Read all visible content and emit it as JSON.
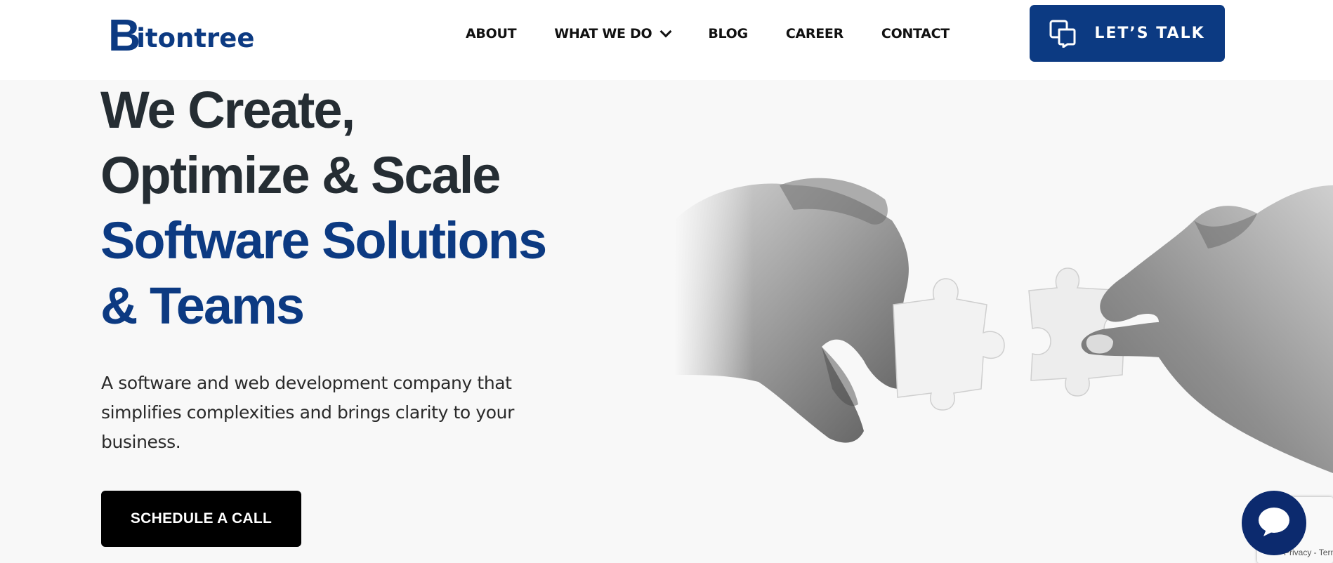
{
  "header": {
    "logo": {
      "initial": "B",
      "rest": "itontree"
    },
    "nav": [
      {
        "label": "ABOUT"
      },
      {
        "label": "WHAT WE DO",
        "has_dropdown": true
      },
      {
        "label": "BLOG"
      },
      {
        "label": "CAREER"
      },
      {
        "label": "CONTACT"
      }
    ],
    "cta": {
      "label": "LET’S TALK",
      "icon": "chat-bubbles-icon"
    }
  },
  "hero": {
    "title_lines": [
      {
        "text": "We Create,",
        "tone": "dark"
      },
      {
        "text": "Optimize & Scale",
        "tone": "dark"
      },
      {
        "text": "Software Solutions",
        "tone": "blue"
      },
      {
        "text": "& Teams",
        "tone": "blue"
      }
    ],
    "description": "A software and web development company that simplifies complexities and brings clarity to your business.",
    "cta_label": "SCHEDULE A CALL",
    "image": "hands-holding-puzzle-pieces"
  },
  "recaptcha": {
    "links": "Privacy - Terms"
  },
  "chat_widget": {
    "icon": "chat-icon"
  },
  "colors": {
    "brand_blue": "#0c3a82",
    "dark_text": "#252d33",
    "cta_black": "#000000",
    "chat_navy": "#0c2a6e",
    "page_bg": "#f8f8f8"
  }
}
